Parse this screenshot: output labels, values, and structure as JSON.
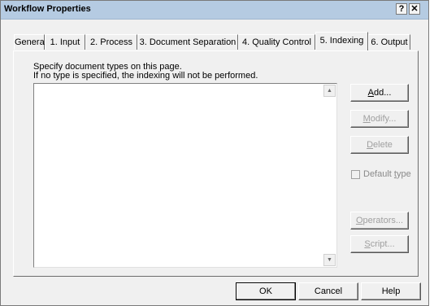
{
  "window": {
    "title": "Workflow Properties",
    "help_button": "?",
    "close_button": "✕"
  },
  "tabs": [
    {
      "label": "General",
      "active": false
    },
    {
      "label": "1. Input",
      "active": false
    },
    {
      "label": "2. Process",
      "active": false
    },
    {
      "label": "3. Document Separation",
      "active": false
    },
    {
      "label": "4. Quality Control",
      "active": false
    },
    {
      "label": "5. Indexing",
      "active": true
    },
    {
      "label": "6. Output",
      "active": false
    }
  ],
  "description": {
    "line1": "Specify document types on this page.",
    "line2": "If no type is specified, the indexing will not be performed."
  },
  "document_types": {
    "items": []
  },
  "scroll": {
    "up_glyph": "▲",
    "down_glyph": "▼"
  },
  "side_buttons": {
    "add": {
      "mnemonic": "A",
      "rest": "dd...",
      "enabled": true
    },
    "modify": {
      "mnemonic": "M",
      "rest": "odify...",
      "enabled": false
    },
    "delete": {
      "mnemonic": "D",
      "rest": "elete",
      "enabled": false
    },
    "operators": {
      "mnemonic": "O",
      "rest": "perators...",
      "enabled": false
    },
    "script": {
      "mnemonic": "S",
      "rest": "cript...",
      "enabled": false
    }
  },
  "default_type": {
    "label_prefix": "Default ",
    "mnemonic": "t",
    "label_suffix": "ype",
    "checked": false,
    "enabled": false
  },
  "footer": {
    "ok": "OK",
    "cancel": "Cancel",
    "help": "Help"
  }
}
